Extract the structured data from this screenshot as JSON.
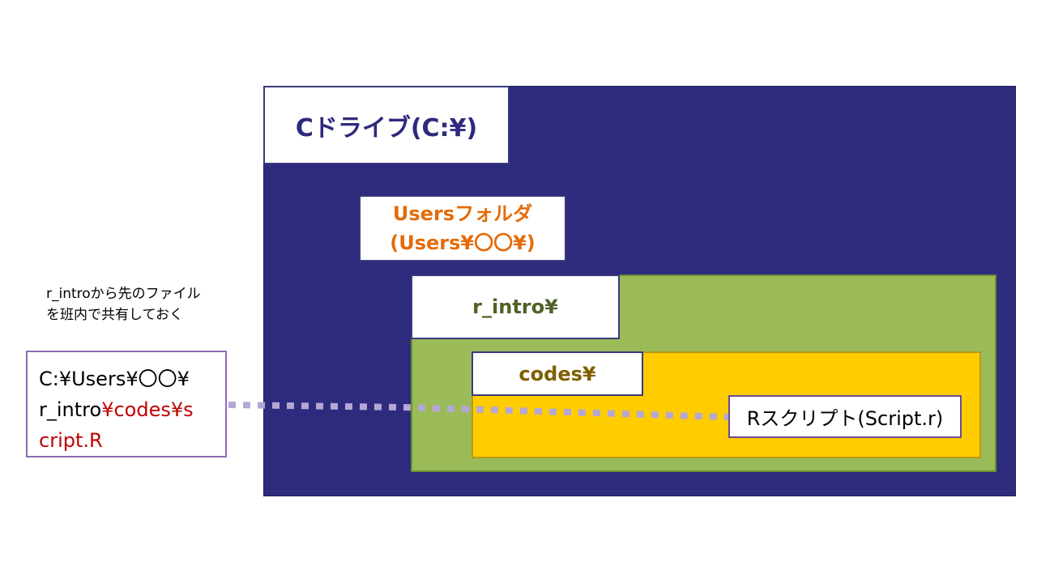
{
  "colors": {
    "drive_bg": "#2e2a7e",
    "drive_text": "#2e2a7e",
    "users_text": "#e36c0a",
    "rintro_bg": "#9bbb59",
    "rintro_text": "#4f6228",
    "codes_bg": "#ffcc00",
    "codes_text": "#7f6000",
    "path_red": "#c00000",
    "connector": "#b4a7d6"
  },
  "drive": {
    "label": "Cドライブ(C:¥)"
  },
  "users_folder": {
    "line1": "Usersフォルダ",
    "line2": "(Users¥〇〇¥)"
  },
  "r_intro": {
    "label": "r_intro¥"
  },
  "codes": {
    "label": "codes¥"
  },
  "script": {
    "label": "Rスクリプト(Script.r)"
  },
  "note": {
    "line1": "r_introから先のファイル",
    "line2": "を班内で共有しておく"
  },
  "path": {
    "line1": "C:¥Users¥〇〇¥",
    "line2_plain": "r_intro",
    "line2_red": "¥codes¥s",
    "line3_red": "cript.R"
  }
}
